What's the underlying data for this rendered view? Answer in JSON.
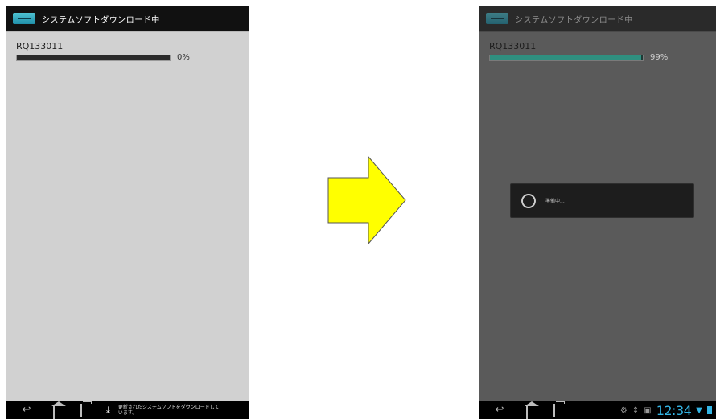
{
  "left_screen": {
    "title": "システムソフトダウンロード中",
    "download_item": {
      "name": "RQ133011",
      "progress_percent": 0,
      "progress_label": "0%"
    },
    "notification": {
      "text": "更新されたシステムソフトをダウンロードしています。"
    }
  },
  "right_screen": {
    "title": "システムソフトダウンロード中",
    "download_item": {
      "name": "RQ133011",
      "progress_percent": 99,
      "progress_label": "99%"
    },
    "dialog": {
      "text": "準備中..."
    },
    "status_bar": {
      "clock": "12:34"
    }
  },
  "colors": {
    "accent": "#33b5e5",
    "progress": "#2f8f7f",
    "arrow_fill": "#ffff00"
  },
  "icons": {
    "back": "back-icon",
    "home": "home-icon",
    "recent": "recent-apps-icon",
    "download": "download-icon",
    "transition": "right-arrow-icon"
  }
}
